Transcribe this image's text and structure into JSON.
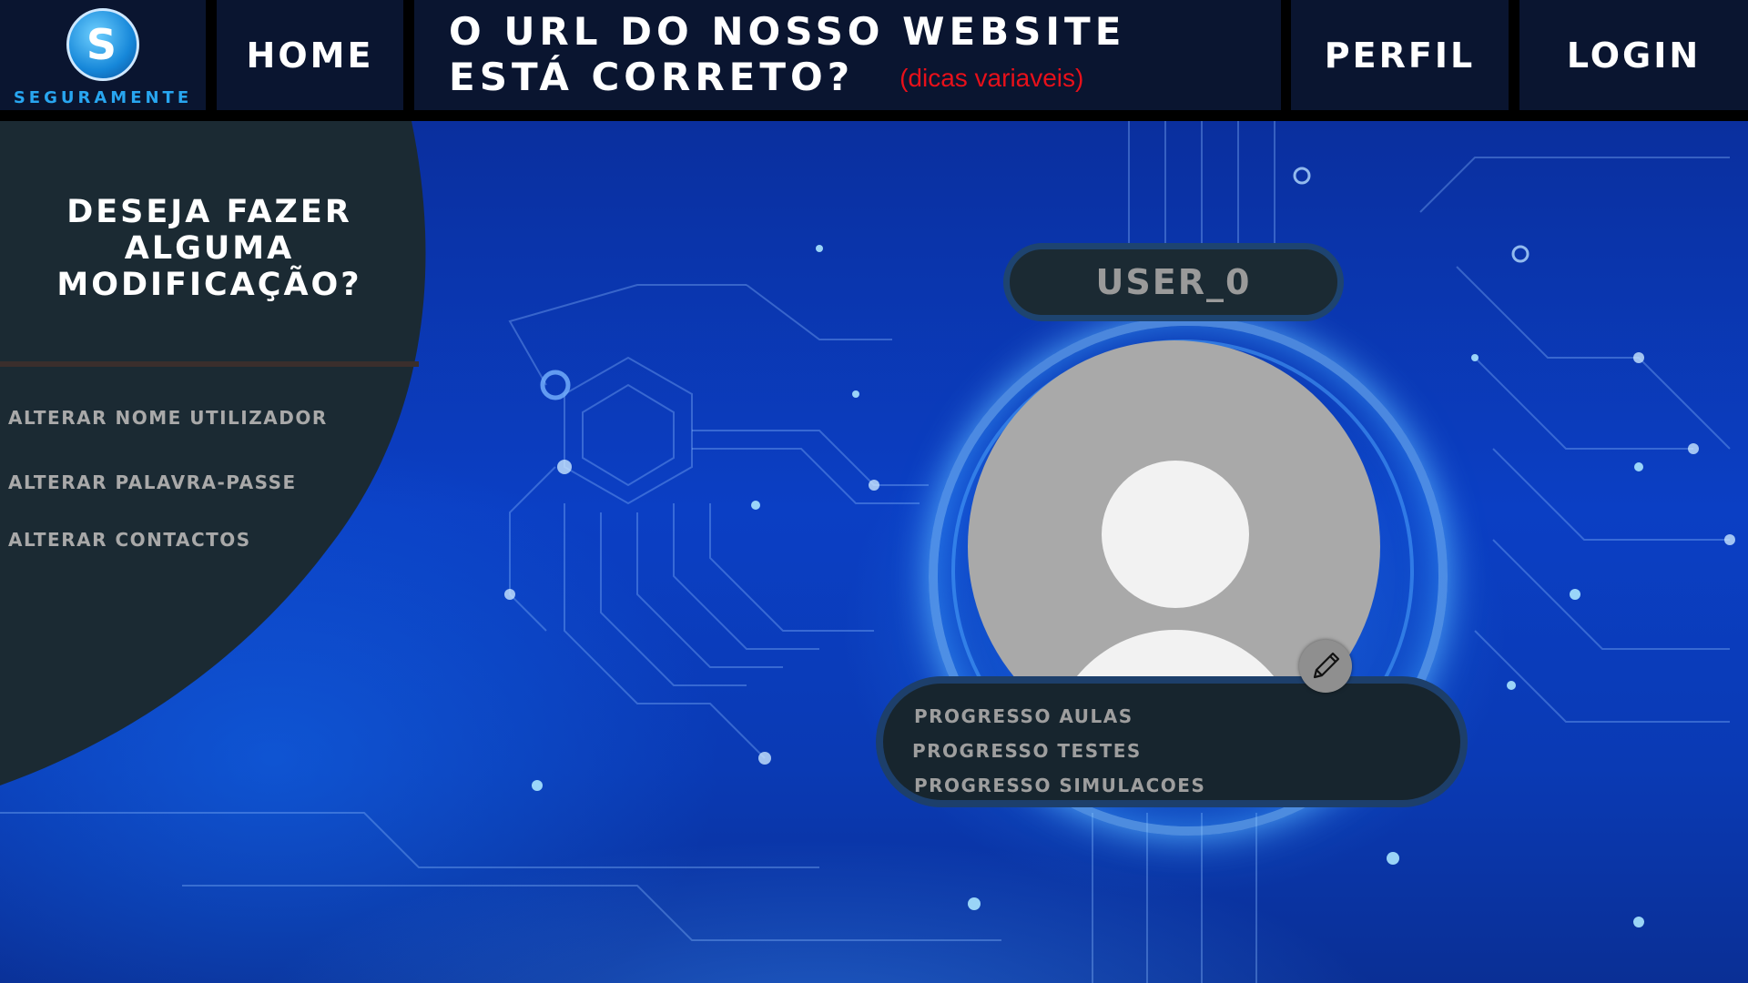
{
  "header": {
    "logo_text": "SEGURAMENTE",
    "logo_glyph": "S",
    "nav_home": "HOME",
    "title_line1": "O URL DO NOSSO WEBSITE",
    "title_line2": "ESTÁ CORRETO?",
    "title_hint": "(dicas variaveis)",
    "nav_perfil": "PERFIL",
    "nav_login": "LOGIN"
  },
  "sidebar": {
    "heading_line1": "DESEJA FAZER",
    "heading_line2": "ALGUMA",
    "heading_line3": "MODIFICAÇÃO?",
    "items": [
      {
        "label": "ALTERAR NOME UTILIZADOR"
      },
      {
        "label": "ALTERAR PALAVRA-PASSE"
      },
      {
        "label": "ALTERAR CONTACTOS"
      }
    ]
  },
  "profile": {
    "username": "USER_0",
    "edit_icon": "pencil-icon",
    "progress": [
      {
        "label": "PROGRESSO AULAS"
      },
      {
        "label": "PROGRESSO TESTES"
      },
      {
        "label": "PROGRESSO SIMULACOES"
      }
    ]
  },
  "colors": {
    "header_bg": "#0a1530",
    "panel_bg": "#1b2a33",
    "hint_red": "#e8101a",
    "logo_blue": "#28a6f0",
    "menu_text": "#a9a9a9"
  }
}
